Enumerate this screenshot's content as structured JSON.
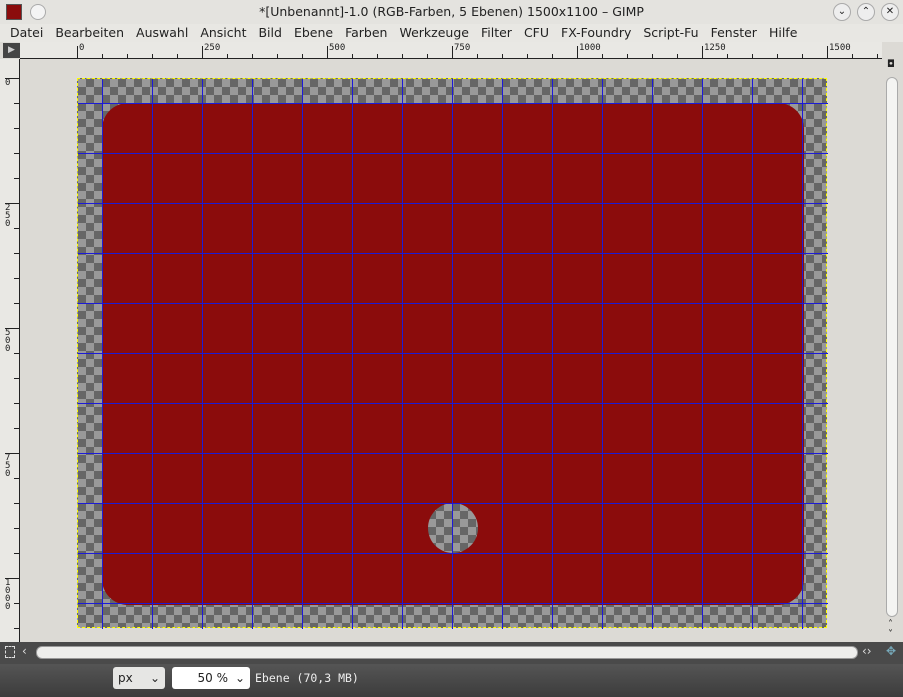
{
  "window": {
    "title": "*[Unbenannt]-1.0 (RGB-Farben, 5 Ebenen) 1500x1100 – GIMP",
    "minimize": "⌄",
    "maximize": "⌃",
    "close": "✕"
  },
  "menu": [
    "Datei",
    "Bearbeiten",
    "Auswahl",
    "Ansicht",
    "Bild",
    "Ebene",
    "Farben",
    "Werkzeuge",
    "Filter",
    "CFU",
    "FX-Foundry",
    "Script-Fu",
    "Fenster",
    "Hilfe"
  ],
  "hruler_labels": [
    "0",
    "250",
    "500",
    "750",
    "1000",
    "1250",
    "1500"
  ],
  "vruler_labels": [
    "0",
    "250",
    "500",
    "750",
    "1000"
  ],
  "statusbar": {
    "unit": "px",
    "zoom": "50 %",
    "status": "Ebene (70,3 MB)"
  },
  "colors": {
    "layer_fill": "#8b0c0c",
    "guides": "#1b1bd8"
  }
}
